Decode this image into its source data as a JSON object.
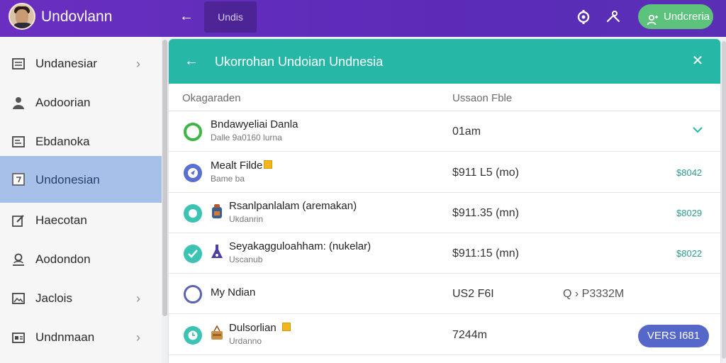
{
  "header": {
    "app_title": "Undovlann",
    "tab_label": "Undis",
    "action_button_label": "Undcreria",
    "icons": [
      "avatar",
      "back-arrow-icon",
      "settings-icon",
      "share-icon",
      "user-group-icon"
    ],
    "accent_color": "#5b2bb8"
  },
  "sidebar": {
    "items": [
      {
        "label": "Undanesiar",
        "icon": "list-icon",
        "chevron": true,
        "active": false
      },
      {
        "label": "Aodoorian",
        "icon": "person-icon",
        "chevron": false,
        "active": false
      },
      {
        "label": "Ebdanoka",
        "icon": "document-icon",
        "chevron": false,
        "active": false
      },
      {
        "label": "Undonesian",
        "icon": "calendar-icon",
        "chevron": false,
        "active": true
      },
      {
        "label": "Haecotan",
        "icon": "edit-icon",
        "chevron": false,
        "active": false
      },
      {
        "label": "Aodondon",
        "icon": "user-icon",
        "chevron": false,
        "active": false
      },
      {
        "label": "Jaclois",
        "icon": "image-icon",
        "chevron": true,
        "active": false
      },
      {
        "label": "Undnmaan",
        "icon": "card-icon",
        "chevron": true,
        "active": false
      }
    ]
  },
  "panel": {
    "title": "Ukorrohan Undoian Undnesia",
    "header_color": "#27b7a6",
    "columns": [
      "Okagaraden",
      "Ussaon Fble"
    ],
    "rows": [
      {
        "name": "Bndawyeliai Danla",
        "sub": "Dalle 9a0160 lurna",
        "size": "01am",
        "extra": "",
        "price": "",
        "button": "",
        "status_icon": "ring-green",
        "item_icon": "",
        "badge": false,
        "chevron": true
      },
      {
        "name": "Mealt Filde",
        "sub": "Bame ba",
        "size": "$911 L5 (mo)",
        "extra": "",
        "price": "$8042",
        "button": "",
        "status_icon": "circle-blue-arrow",
        "item_icon": "",
        "badge": true,
        "chevron": false
      },
      {
        "name": "Rsanlpanlalam (aremakan)",
        "sub": "Ukdanrin",
        "size": "$911.35 (mn)",
        "extra": "",
        "price": "$8029",
        "button": "",
        "status_icon": "circle-teal",
        "item_icon": "backpack-icon",
        "badge": false,
        "chevron": false
      },
      {
        "name": "Seyakagguloahham: (nukelar)",
        "sub": "Uscanub",
        "size": "$911:15 (mn)",
        "extra": "",
        "price": "$8022",
        "button": "",
        "status_icon": "circle-teal-check",
        "item_icon": "flask-icon",
        "badge": false,
        "chevron": false
      },
      {
        "name": "My Ndian",
        "sub": "",
        "size": "US2 F6I",
        "extra": "Q › P3332M",
        "price": "",
        "button": "",
        "status_icon": "ring-indigo",
        "item_icon": "",
        "badge": false,
        "chevron": false
      },
      {
        "name": "Dulsorlian",
        "sub": "Urdanno",
        "size": "7244m",
        "extra": "",
        "price": "",
        "button": "VERS I681",
        "status_icon": "circle-teal-clock",
        "item_icon": "basket-icon",
        "badge": true,
        "chevron": false
      }
    ]
  }
}
